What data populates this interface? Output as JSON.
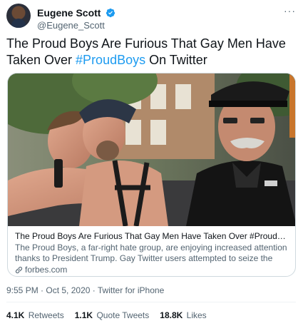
{
  "author": {
    "name": "Eugene Scott",
    "handle": "@Eugene_Scott",
    "verified_color": "#1d9bf0"
  },
  "more_icon": "···",
  "tweet": {
    "text_before": "The Proud Boys Are Furious That Gay Men Have Taken Over ",
    "hashtag": "#ProudBoys",
    "text_after": " On Twitter"
  },
  "card": {
    "title": "The Proud Boys Are Furious That Gay Men Have Taken Over #ProudBoys On ...",
    "description": "The Proud Boys, a far-right hate group, are enjoying increased attention thanks to President Trump. Gay Twitter users attempted to seize the spotligh...",
    "domain": "forbes.com",
    "image_alt": "Two men kissing beside a man in a leather police-style cap"
  },
  "meta": {
    "time": "9:55 PM",
    "separator": " · ",
    "date": "Oct 5, 2020",
    "client": "Twitter for iPhone"
  },
  "stats": {
    "retweets_count": "4.1K",
    "retweets_label": "Retweets",
    "quotes_count": "1.1K",
    "quotes_label": "Quote Tweets",
    "likes_count": "18.8K",
    "likes_label": "Likes"
  },
  "colors": {
    "accent": "#1d9bf0",
    "secondary_text": "#536471",
    "border": "#cfd9de"
  }
}
